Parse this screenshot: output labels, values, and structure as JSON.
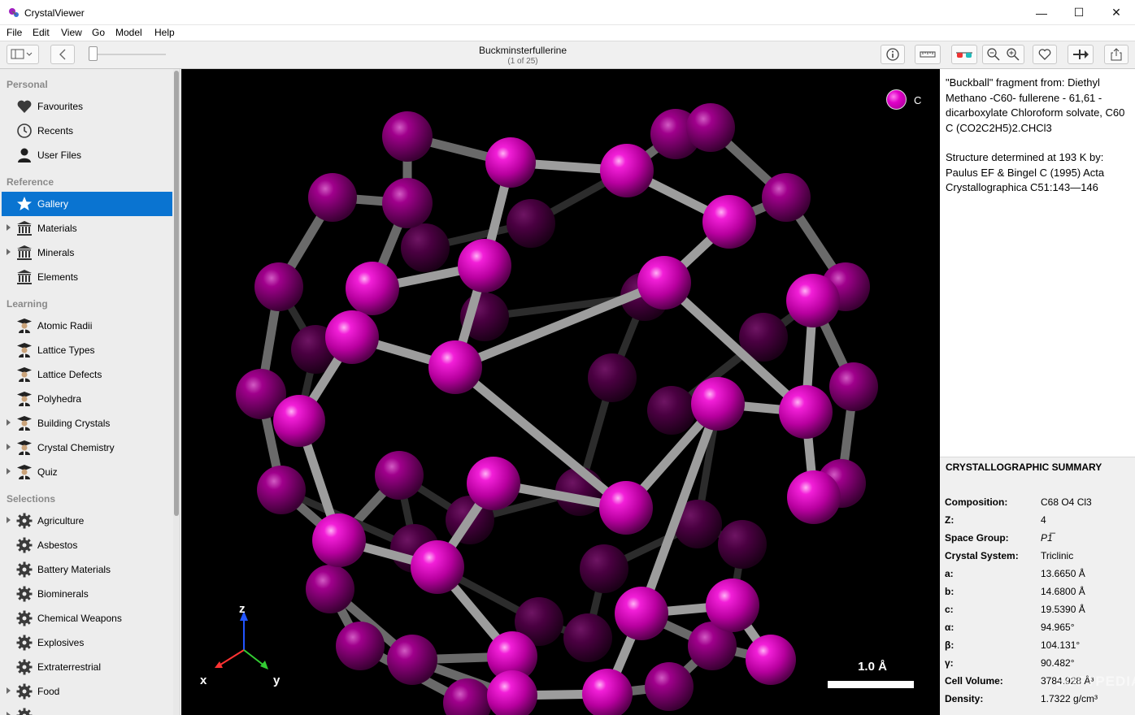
{
  "window": {
    "title": "CrystalViewer",
    "minimize": "—",
    "maximize": "☐",
    "close": "✕"
  },
  "menu": [
    "File",
    "Edit",
    "View",
    "Go",
    "Model",
    "Help"
  ],
  "toolbar": {
    "document_title": "Buckminsterfullerine",
    "document_counter": "(1 of 25)"
  },
  "sidebar": {
    "sections": [
      {
        "heading": "Personal",
        "items": [
          {
            "label": "Favourites",
            "icon": "heart-icon"
          },
          {
            "label": "Recents",
            "icon": "clock-icon"
          },
          {
            "label": "User Files",
            "icon": "user-icon"
          }
        ]
      },
      {
        "heading": "Reference",
        "items": [
          {
            "label": "Gallery",
            "icon": "star-icon",
            "selected": true
          },
          {
            "label": "Materials",
            "icon": "museum-icon",
            "expandable": true
          },
          {
            "label": "Minerals",
            "icon": "museum-icon",
            "expandable": true
          },
          {
            "label": "Elements",
            "icon": "museum-icon"
          }
        ]
      },
      {
        "heading": "Learning",
        "items": [
          {
            "label": "Atomic Radii",
            "icon": "professor-icon"
          },
          {
            "label": "Lattice Types",
            "icon": "professor-icon"
          },
          {
            "label": "Lattice Defects",
            "icon": "professor-icon"
          },
          {
            "label": "Polyhedra",
            "icon": "professor-icon"
          },
          {
            "label": "Building Crystals",
            "icon": "professor-icon",
            "expandable": true
          },
          {
            "label": "Crystal Chemistry",
            "icon": "professor-icon",
            "expandable": true
          },
          {
            "label": "Quiz",
            "icon": "professor-icon",
            "expandable": true
          }
        ]
      },
      {
        "heading": "Selections",
        "items": [
          {
            "label": "Agriculture",
            "icon": "gear-icon",
            "expandable": true
          },
          {
            "label": "Asbestos",
            "icon": "gear-icon"
          },
          {
            "label": "Battery Materials",
            "icon": "gear-icon"
          },
          {
            "label": "Biominerals",
            "icon": "gear-icon"
          },
          {
            "label": "Chemical Weapons",
            "icon": "gear-icon"
          },
          {
            "label": "Explosives",
            "icon": "gear-icon"
          },
          {
            "label": "Extraterrestrial",
            "icon": "gear-icon"
          },
          {
            "label": "Food",
            "icon": "gear-icon",
            "expandable": true
          },
          {
            "label": "",
            "icon": "gear-icon",
            "expandable": true
          }
        ]
      }
    ]
  },
  "viewer": {
    "legend_element": "C",
    "legend_color": "#e100c9",
    "scale_label": "1.0 Å",
    "axis_labels": {
      "z": "z",
      "x": "x",
      "y": "y"
    },
    "axis_colors": {
      "z": "#2255ff",
      "x": "#ff3333",
      "y": "#33cc33"
    }
  },
  "info": {
    "paragraph1": "\"Buckball\" fragment from: Diethyl Methano -C60- fullerene - 61,61 - dicarboxylate Chloroform solvate, C60 C (CO2C2H5)2.CHCl3",
    "paragraph2": "Structure determined at 193 K by: Paulus EF & Bingel C (1995) Acta Crystallographica C51:143—146"
  },
  "summary": {
    "title": "CRYSTALLOGRAPHIC SUMMARY",
    "rows": [
      {
        "key": "Composition:",
        "value": "C68 O4 Cl3"
      },
      {
        "key": "Z:",
        "value": "4"
      },
      {
        "key": "Space Group:",
        "value": "P1̅"
      },
      {
        "key": "Crystal System:",
        "value": "Triclinic"
      },
      {
        "key": "a:",
        "value": "13.6650 Å"
      },
      {
        "key": "b:",
        "value": "14.6800 Å"
      },
      {
        "key": "c:",
        "value": "19.5390 Å"
      },
      {
        "key": "α:",
        "value": "94.965°"
      },
      {
        "key": "β:",
        "value": "104.131°"
      },
      {
        "key": "γ:",
        "value": "90.482°"
      },
      {
        "key": "Cell Volume:",
        "value": "3784.928 Å³"
      },
      {
        "key": "Density:",
        "value": "1.7322 g/cm³"
      }
    ]
  },
  "watermark": "SOFTPEDIA"
}
